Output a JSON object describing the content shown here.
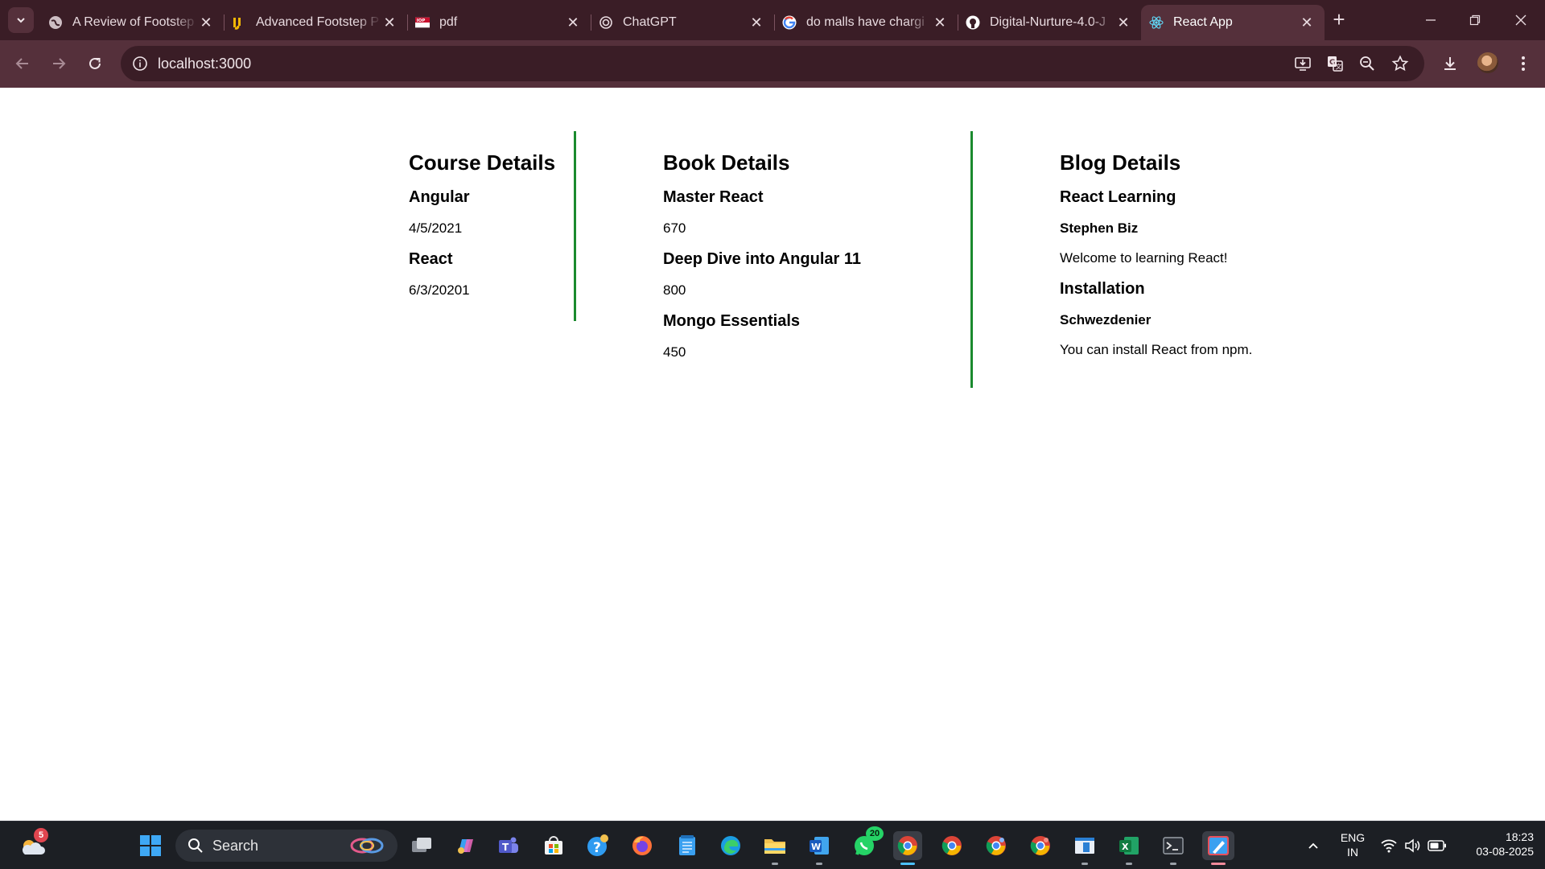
{
  "browser": {
    "tabs": [
      {
        "title": "A Review of Footstep",
        "icon": "globe-icon"
      },
      {
        "title": "Advanced Footstep P",
        "icon": "ij-icon"
      },
      {
        "title": "pdf",
        "icon": "iop-icon"
      },
      {
        "title": "ChatGPT",
        "icon": "chatgpt-icon"
      },
      {
        "title": "do malls have chargi",
        "icon": "google-icon"
      },
      {
        "title": "Digital-Nurture-4.0-J",
        "icon": "github-icon"
      },
      {
        "title": "React App",
        "icon": "react-icon",
        "active": true
      }
    ],
    "url": "localhost:3000",
    "colors": {
      "frame": "#3a1d26",
      "toolbar": "#55303b"
    }
  },
  "page": {
    "course": {
      "heading": "Course Details",
      "items": [
        {
          "name": "Angular",
          "date": "4/5/2021"
        },
        {
          "name": "React",
          "date": "6/3/20201"
        }
      ]
    },
    "book": {
      "heading": "Book Details",
      "items": [
        {
          "name": "Master React",
          "price": "670"
        },
        {
          "name": "Deep Dive into Angular 11",
          "price": "800"
        },
        {
          "name": "Mongo Essentials",
          "price": "450"
        }
      ]
    },
    "blog": {
      "heading": "Blog Details",
      "items": [
        {
          "title": "React Learning",
          "author": "Stephen Biz",
          "content": "Welcome to learning React!"
        },
        {
          "title": "Installation",
          "author": "Schwezdenier",
          "content": "You can install React from npm."
        }
      ]
    },
    "divider_color": "#1a8a2e"
  },
  "taskbar": {
    "weather_badge": "5",
    "search_label": "Search",
    "whatsapp_badge": "20",
    "lang": "ENG",
    "region": "IN",
    "time": "18:23",
    "date": "03-08-2025"
  }
}
